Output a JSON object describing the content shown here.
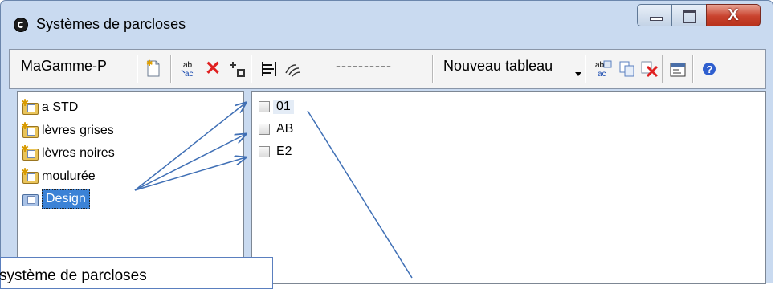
{
  "window": {
    "title": "Systèmes de parcloses",
    "controls": {
      "minimize": "–",
      "maximize": "□",
      "close": "X"
    }
  },
  "toolbar": {
    "range_combo": "MaGamme-P",
    "dashes": "----------",
    "new_table_label": "Nouveau tableau",
    "icons": [
      "new-document-icon",
      "rename-icon",
      "delete-icon",
      "replace-icon",
      "align-icon",
      "link-icon",
      "rename-table-icon",
      "copy-icon",
      "delete-table-icon",
      "properties-icon",
      "help-icon"
    ]
  },
  "tree": {
    "items": [
      {
        "label": "a STD",
        "icon": "folder-star-icon"
      },
      {
        "label": "lèvres grises",
        "icon": "folder-star-icon"
      },
      {
        "label": "lèvres noires",
        "icon": "folder-star-icon"
      },
      {
        "label": "moulurée",
        "icon": "folder-star-icon"
      },
      {
        "label": "Design",
        "icon": "folder-design-icon",
        "selected": true
      }
    ]
  },
  "list": {
    "items": [
      {
        "label": "01",
        "checked": false
      },
      {
        "label": "AB",
        "checked": false
      },
      {
        "label": "E2",
        "checked": false
      }
    ]
  },
  "callout": {
    "text": "système de parcloses"
  },
  "colors": {
    "window_frame": "#c9daf0",
    "selection": "#3b82d6",
    "arrow": "#3f6fb5",
    "close_button": "#c9432e"
  }
}
